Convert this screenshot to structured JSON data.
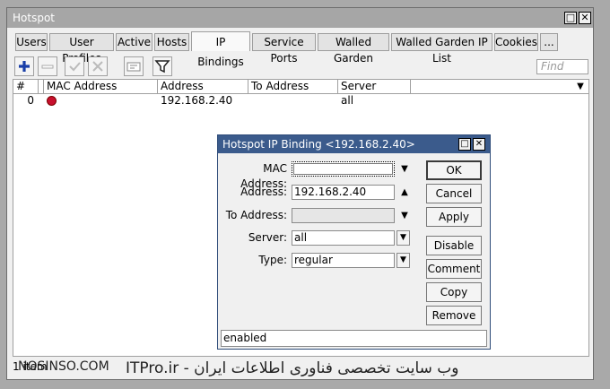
{
  "window": {
    "title": "Hotspot"
  },
  "tabs": [
    "Users",
    "User Profiles",
    "Active",
    "Hosts",
    "IP Bindings",
    "Service Ports",
    "Walled Garden",
    "Walled Garden IP List",
    "Cookies",
    "..."
  ],
  "active_tab": "IP Bindings",
  "search": {
    "placeholder": "Find"
  },
  "table": {
    "columns": [
      "#",
      "MAC Address",
      "Address",
      "To Address",
      "Server"
    ],
    "rows": [
      {
        "num": "0",
        "mac": "",
        "address": "192.168.2.40",
        "to_address": "",
        "server": "all"
      }
    ]
  },
  "status_bar": {
    "items": "1 item"
  },
  "watermark": "ITPro.ir - وب سایت تخصصی فناوری اطلاعات ایران",
  "watermark_left": "NOSINSO.COM",
  "dialog": {
    "title": "Hotspot IP Binding <192.168.2.40>",
    "fields": {
      "mac_label": "MAC Address:",
      "mac_value": "",
      "address_label": "Address:",
      "address_value": "192.168.2.40",
      "to_address_label": "To Address:",
      "to_address_value": "",
      "server_label": "Server:",
      "server_value": "all",
      "type_label": "Type:",
      "type_value": "regular"
    },
    "buttons": {
      "ok": "OK",
      "cancel": "Cancel",
      "apply": "Apply",
      "disable": "Disable",
      "comment": "Comment",
      "copy": "Copy",
      "remove": "Remove"
    },
    "status": "enabled"
  },
  "colors": {
    "add_icon": "#1a3fa8",
    "filter_icon": "#222222",
    "dialog_title_bg": "#3b5b8c"
  }
}
